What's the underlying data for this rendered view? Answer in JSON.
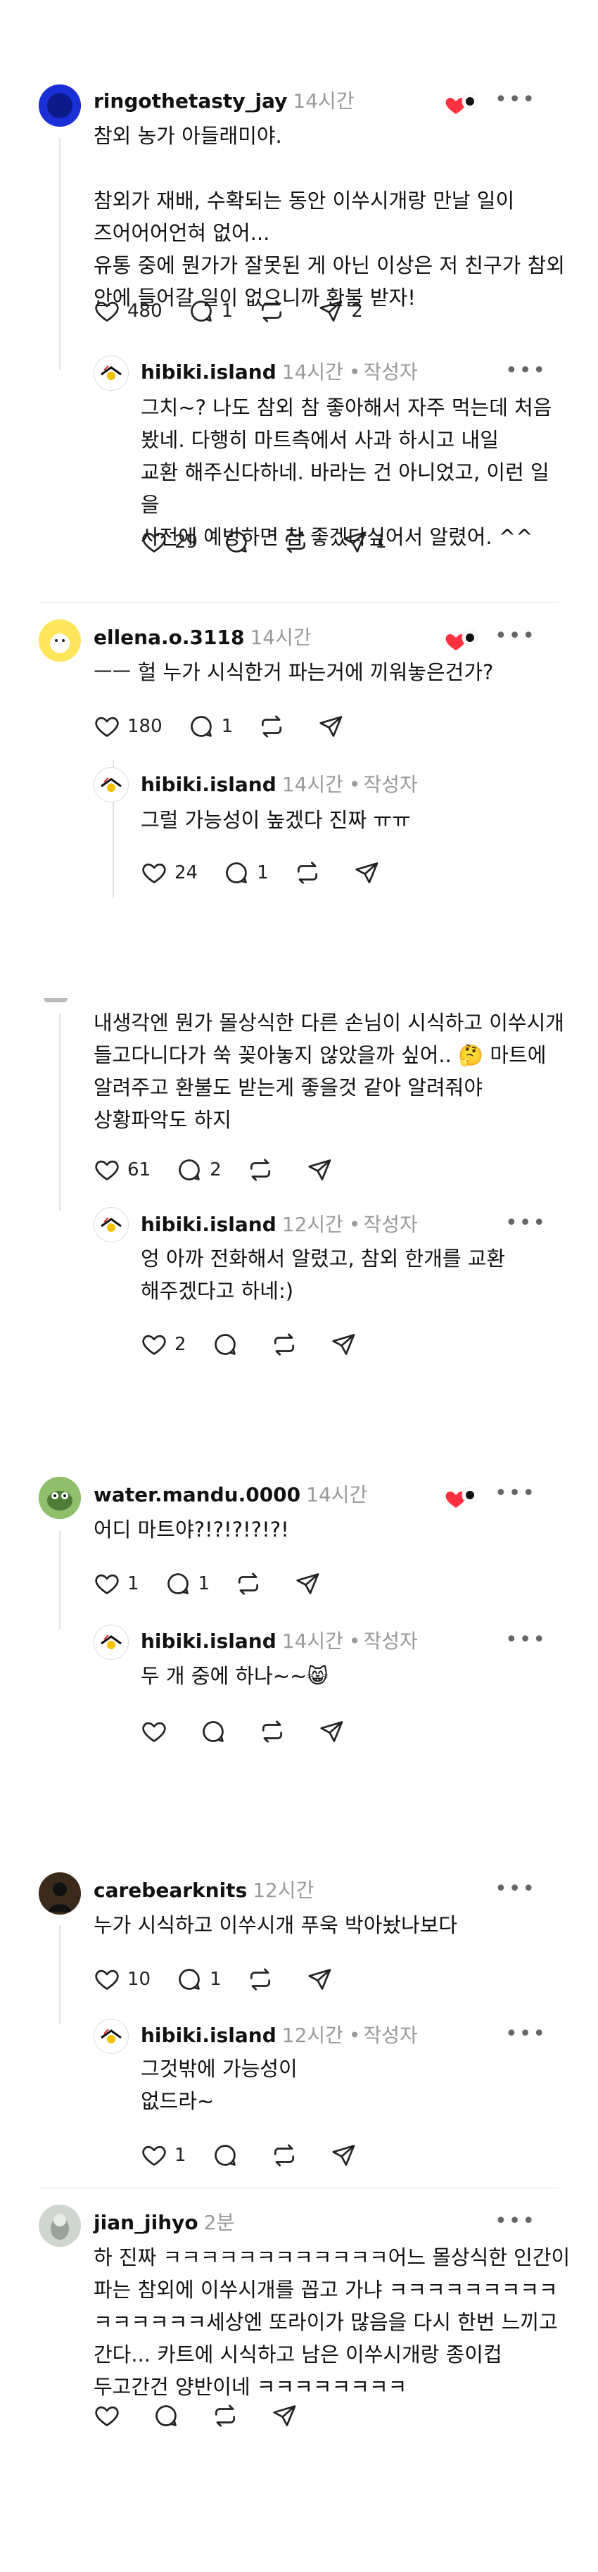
{
  "comments": [
    {
      "user": "ringothetasty_jay",
      "time": "14시간",
      "text": "참외 농가 아들래미야.\n\n참외가 재배, 수확되는 동안 이쑤시개랑 만날 일이\n즈어어어언혀 없어...\n유통 중에 뭔가가 잘못된 게 아닌 이상은 저 친구가 참외\n안에 들어갈 일이 없으니까 환불 받자!",
      "likes": "480",
      "replies": "1",
      "shares": "2",
      "reply": {
        "user": "hibiki.island",
        "time": "14시간",
        "author": "작성자",
        "text": "그치~? 나도 참외 참 좋아해서 자주 먹는데 처음\n봤네. 다행히 마트측에서 사과 하시고 내일\n교환 해주신다하네. 바라는 건 아니었고, 이런 일을\n사전에 예방하면 참 좋겠다싶어서 알렸어. ^^",
        "likes": "29",
        "replies": "",
        "shares": "1"
      }
    },
    {
      "user": "ellena.o.3118",
      "time": "14시간",
      "text": "ㅡㅡ 헐 누가 시식한거 파는거에 끼워놓은건가?",
      "likes": "180",
      "replies": "1",
      "shares": "",
      "reply": {
        "user": "hibiki.island",
        "time": "14시간",
        "author": "작성자",
        "text": "그럴 가능성이 높겠다 진짜 ㅠㅠ",
        "likes": "24",
        "replies": "1",
        "shares": ""
      }
    },
    {
      "user": "",
      "time": "",
      "text": "내생각엔 뭔가 몰상식한 다른 손님이 시식하고 이쑤시개\n들고다니다가 쑥 꽂아놓지 않았을까 싶어.. 🤔 마트에\n알려주고 환불도 받는게 좋을것 같아 알려줘야\n상황파악도 하지",
      "likes": "61",
      "replies": "2",
      "shares": "",
      "reply": {
        "user": "hibiki.island",
        "time": "12시간",
        "author": "작성자",
        "text": "엉 아까 전화해서 알렸고, 참외 한개를 교환\n해주겠다고 하네:)",
        "likes": "2",
        "replies": "",
        "shares": ""
      }
    },
    {
      "user": "water.mandu.0000",
      "time": "14시간",
      "text": "어디 마트야?!?!?!?!?!",
      "likes": "1",
      "replies": "1",
      "shares": "",
      "reply": {
        "user": "hibiki.island",
        "time": "14시간",
        "author": "작성자",
        "text": "두 개 중에 하나~~😸",
        "likes": "",
        "replies": "",
        "shares": ""
      }
    },
    {
      "user": "carebearknits",
      "time": "12시간",
      "text": "누가 시식하고 이쑤시개 푸욱 박아놨나보다",
      "likes": "10",
      "replies": "1",
      "shares": "",
      "reply": {
        "user": "hibiki.island",
        "time": "12시간",
        "author": "작성자",
        "text": "그것밖에 가능성이\n없드라~",
        "likes": "1",
        "replies": "",
        "shares": ""
      }
    },
    {
      "user": "jian_jihyo",
      "time": "2분",
      "text": "하 진짜 ㅋㅋㅋㅋㅋㅋㅋㅋㅋㅋㅋㅋ어느 몰상식한 인간이\n파는 참외에 이쑤시개를 꼽고 가냐 ㅋㅋㅋㅋㅋㅋㅋㅋㅋ\nㅋㅋㅋㅋㅋㅋ세상엔 또라이가 많음을 다시 한번 느끼고\n간다... 카트에 시식하고 남은 이쑤시개랑 종이컵\n두고간건 양반이네 ㅋㅋㅋㅋㅋㅋㅋㅋ",
      "likes": "",
      "replies": "",
      "shares": ""
    }
  ],
  "colors": {
    "liked_heart": "#ff3040",
    "muted": "#999999"
  },
  "icons": [
    "heart-icon",
    "comment-icon",
    "repost-icon",
    "share-icon",
    "more-icon"
  ]
}
